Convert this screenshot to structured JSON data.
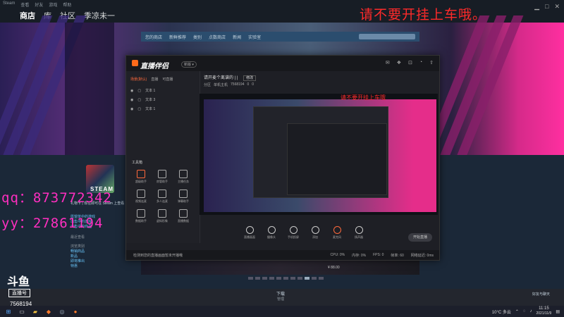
{
  "steam": {
    "menu": [
      "Steam",
      "查看",
      "好友",
      "游戏",
      "帮助"
    ],
    "nav": [
      "商店",
      "库",
      "社区",
      "季凉未一"
    ],
    "store_tabs": [
      "您的商店",
      "新鲜推荐",
      "类别",
      "点数商店",
      "新闻",
      "实验室"
    ],
    "sidebar_links": [
      "愿望单中的游戏",
      "出售中的游戏",
      "出售中的商品"
    ],
    "sidebar_headers": [
      "最近查看",
      "浏览类别"
    ],
    "sidebar_items": [
      "畅销商品",
      "新品",
      "即将推出",
      "特惠"
    ],
    "steam_word": "STEAM",
    "steam_sub": "礼物卡 | 现在即可在 Steam 上查看",
    "price": "¥ 88.00",
    "download_label": "下载",
    "download_sub": "管理",
    "friends_label": "好友与聊天"
  },
  "overlay": {
    "warning": "请不要开挂上车哦。",
    "qq": "qq：873772342",
    "yy": "yy：27861194"
  },
  "douyu": {
    "logo": "斗鱼",
    "badge": "直播号",
    "room_number": "7568194"
  },
  "companion": {
    "title": "直播伴侣",
    "version": "新版 ▾",
    "tabs": [
      "场景(默认)",
      "直播",
      "可直播"
    ],
    "scenes": [
      "文本 1",
      "文本 3",
      "文本 1"
    ],
    "tools_label": "工具箱",
    "tools": [
      "超级助手",
      "房管助手",
      "主播任务",
      "视频连麦",
      "多人连麦",
      "弹幕助手",
      "数据助手",
      "虚拟形象",
      "直播数据",
      "礼物特效",
      "PK",
      "抽奖"
    ],
    "room_title": "请开麦个离谱的 | |",
    "room_tag": "修改",
    "tags": [
      "分区",
      "单机主机",
      "7568194",
      "0",
      "0"
    ],
    "inner_warning": "请不要开挂上车哦",
    "controls": [
      "直播画面",
      "摄像头",
      "手机投屏",
      "添加",
      "麦克风",
      "扬声器"
    ],
    "start_live": "开始直播",
    "status": [
      "CPU: 0%",
      "内存: 0%",
      "FPS: 0",
      "帧率: 60",
      "网络延迟: 0ms"
    ],
    "tip": "检测到您的直播画面暂未开播哦"
  },
  "taskbar": {
    "weather": "10°C 多云",
    "time": "11:15",
    "date": "2021/11/9"
  }
}
